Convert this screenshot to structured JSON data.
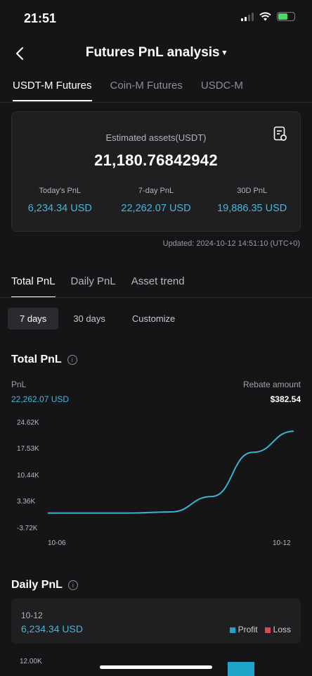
{
  "status_bar": {
    "time": "21:51"
  },
  "header": {
    "title": "Futures PnL analysis",
    "caret": "▾"
  },
  "market_tabs": [
    {
      "label": "USDT-M Futures",
      "active": true
    },
    {
      "label": "Coin-M Futures",
      "active": false
    },
    {
      "label": "USDC-M",
      "active": false
    }
  ],
  "summary": {
    "estimated_label": "Estimated assets(USDT)",
    "estimated_value": "21,180.76842942",
    "metrics": [
      {
        "label": "Today's PnL",
        "value": "6,234.34 USD"
      },
      {
        "label": "7-day PnL",
        "value": "22,262.07 USD"
      },
      {
        "label": "30D PnL",
        "value": "19,886.35 USD"
      }
    ]
  },
  "updated": "Updated: 2024-10-12 14:51:10 (UTC+0)",
  "view_tabs": [
    {
      "label": "Total PnL",
      "active": true
    },
    {
      "label": "Daily PnL",
      "active": false
    },
    {
      "label": "Asset trend",
      "active": false
    }
  ],
  "ranges": [
    {
      "label": "7 days",
      "active": true
    },
    {
      "label": "30 days",
      "active": false
    },
    {
      "label": "Customize",
      "active": false
    }
  ],
  "total_pnl": {
    "title": "Total PnL",
    "pnl_label": "PnL",
    "pnl_value": "22,262.07 USD",
    "rebate_label": "Rebate amount",
    "rebate_value": "$382.54"
  },
  "chart_data": {
    "type": "line",
    "title": "",
    "xlabel": "",
    "ylabel": "",
    "y_ticks": [
      "24.62K",
      "17.53K",
      "10.44K",
      "3.36K",
      "-3.72K"
    ],
    "x_ticks": [
      "10-06",
      "10-12"
    ],
    "ylim": [
      -3720,
      24620
    ],
    "x": [
      "10-06",
      "10-07",
      "10-08",
      "10-09",
      "10-10",
      "10-11",
      "10-12"
    ],
    "series": [
      {
        "values": [
          0,
          0,
          0,
          300,
          4500,
          16500,
          22262.07
        ]
      }
    ],
    "grid": false,
    "color": "#3ab4cf"
  },
  "daily_pnl": {
    "title": "Daily PnL",
    "date": "10-12",
    "value": "6,234.34 USD",
    "legend": [
      {
        "label": "Profit",
        "color": "#1ea5c8"
      },
      {
        "label": "Loss",
        "color": "#e04550"
      }
    ],
    "y_tick": "12.00K"
  },
  "icons": {
    "back": "chevron-left-icon",
    "report": "report-icon",
    "info": "info-icon"
  }
}
